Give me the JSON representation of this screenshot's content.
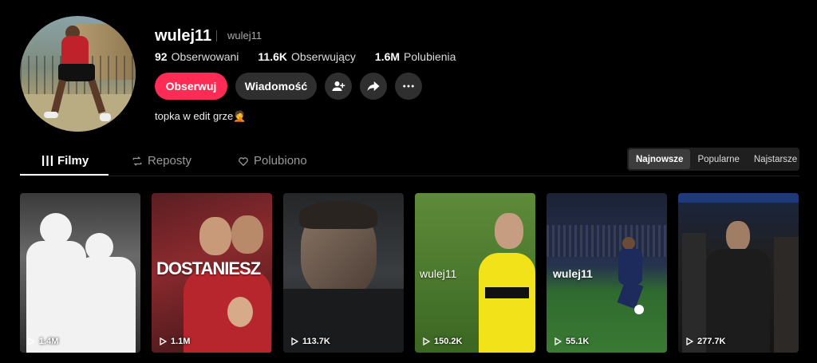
{
  "profile": {
    "username": "wulej11",
    "nickname": "wulej11",
    "bio": "topka w edit grze🤦",
    "stats": [
      {
        "num": "92",
        "label": "Obserwowani"
      },
      {
        "num": "11.6K",
        "label": "Obserwujący"
      },
      {
        "num": "1.6M",
        "label": "Polubienia"
      }
    ]
  },
  "actions": {
    "follow_label": "Obserwuj",
    "message_label": "Wiadomość"
  },
  "tabs": [
    {
      "label": "Filmy",
      "icon": "grid-icon"
    },
    {
      "label": "Reposty",
      "icon": "repost-icon"
    },
    {
      "label": "Polubiono",
      "icon": "heart-icon"
    }
  ],
  "sort": [
    "Najnowsze",
    "Popularne",
    "Najstarsze"
  ],
  "videos": [
    {
      "views": "1.4M",
      "overlay": ""
    },
    {
      "views": "1.1M",
      "overlay": "DOSTANIESZ"
    },
    {
      "views": "113.7K",
      "overlay": ""
    },
    {
      "views": "150.2K",
      "overlay": "wulej11"
    },
    {
      "views": "55.1K",
      "overlay": "wulej11"
    },
    {
      "views": "277.7K",
      "overlay": ""
    }
  ],
  "colors": {
    "accent": "#fe2c55",
    "button_dark": "#2f2f2f",
    "background": "#000000"
  }
}
